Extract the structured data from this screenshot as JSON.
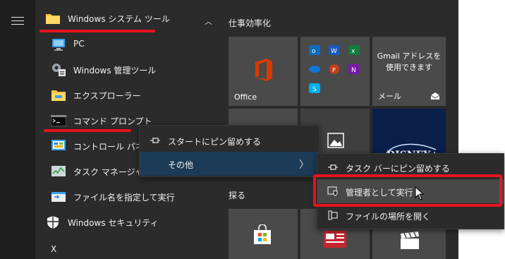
{
  "start_menu": {
    "folder": {
      "label": "Windows システム ツール"
    },
    "apps": [
      {
        "label": "PC",
        "icon": "computer-icon"
      },
      {
        "label": "Windows 管理ツール",
        "icon": "admin-tools-icon"
      },
      {
        "label": "エクスプローラー",
        "icon": "file-explorer-icon"
      },
      {
        "label": "コマンド プロンプト",
        "icon": "command-prompt-icon"
      },
      {
        "label": "コントロール パネル",
        "icon": "control-panel-icon"
      },
      {
        "label": "タスク マネージャー",
        "icon": "task-manager-icon"
      },
      {
        "label": "ファイル名を指定して実行",
        "icon": "run-icon"
      },
      {
        "label": "Windows セキュリティ",
        "icon": "shield-icon"
      }
    ],
    "next_letter": "X"
  },
  "tiles": {
    "group1_title": "仕事効率化",
    "group2_title": "探る",
    "office_label": "Office",
    "gmail_text": "Gmail アドレスを\n使用できます",
    "mail_label": "メール"
  },
  "context_menu": {
    "items": [
      {
        "label": "スタートにピン留めする",
        "icon": "pin-icon"
      },
      {
        "label": "その他",
        "icon": ""
      }
    ],
    "arrow": "〉"
  },
  "submenu": {
    "items": [
      {
        "label": "タスク バーにピン留めする",
        "icon": "pin-icon"
      },
      {
        "label": "管理者として実行",
        "icon": "run-as-admin-icon"
      },
      {
        "label": "ファイルの場所を開く",
        "icon": "open-file-location-icon"
      }
    ]
  },
  "colors": {
    "menu_bg": "#2b2b2b",
    "selected_bg": "#1c3b57",
    "hover_bg": "#484848",
    "annotation_red": "#e8131d",
    "office_orange": "#d83b01",
    "disney_blue": "#0b1f4b"
  }
}
